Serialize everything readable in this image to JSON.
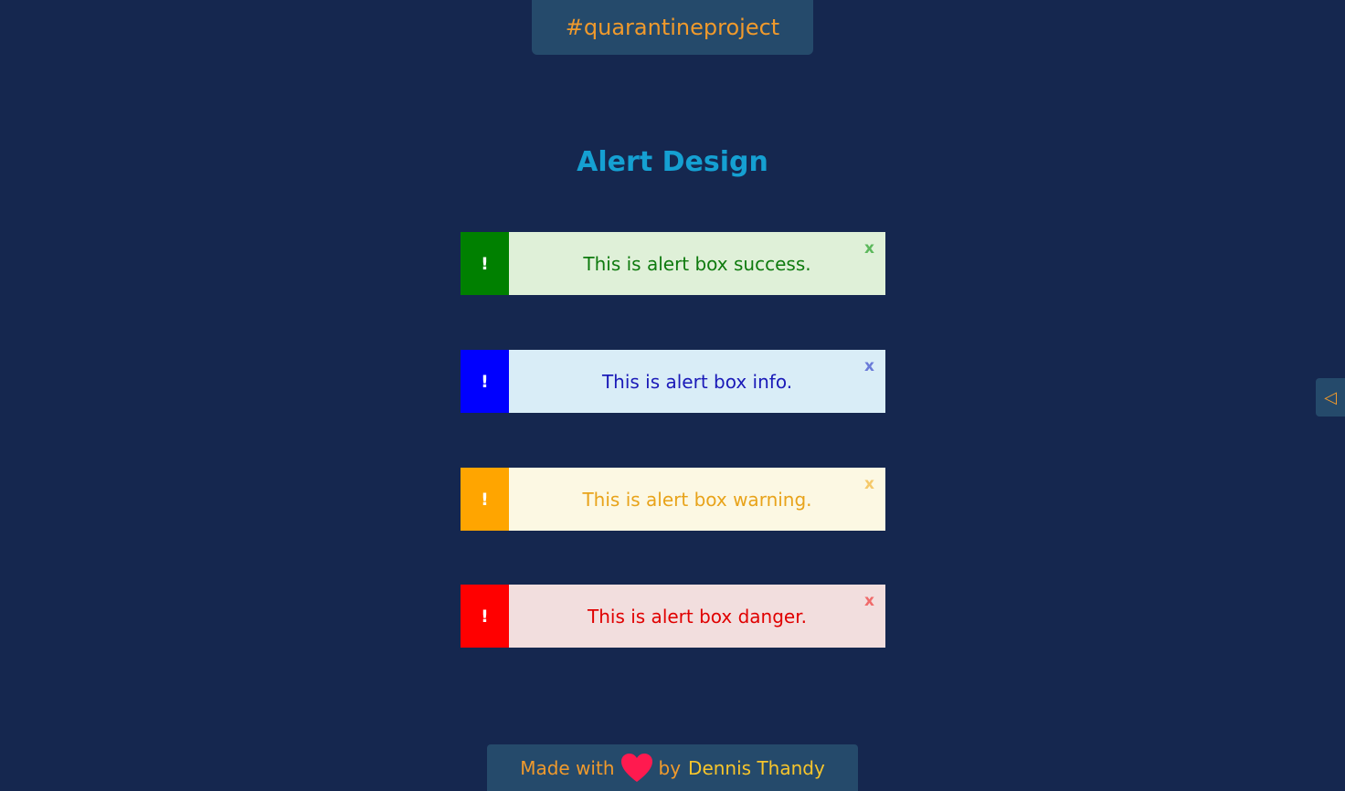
{
  "header": {
    "tag": "#quarantineproject"
  },
  "main": {
    "title": "Alert Design",
    "alerts": [
      {
        "type": "success",
        "icon": "!",
        "message": "This is alert box success.",
        "close": "x",
        "accent": "#008000",
        "background": "#dff0d8",
        "text_color": "#0e7a0e",
        "close_color": "#5cb85c"
      },
      {
        "type": "info",
        "icon": "!",
        "message": "This is alert box info.",
        "close": "x",
        "accent": "#0000ff",
        "background": "#d9edf7",
        "text_color": "#1a1ab8",
        "close_color": "#6a7bd8"
      },
      {
        "type": "warning",
        "icon": "!",
        "message": "This is alert box warning.",
        "close": "x",
        "accent": "#ffa500",
        "background": "#fcf8e3",
        "text_color": "#e8a31a",
        "close_color": "#f5c96a"
      },
      {
        "type": "danger",
        "icon": "!",
        "message": "This is alert box danger.",
        "close": "x",
        "accent": "#ff0000",
        "background": "#f2dede",
        "text_color": "#e00000",
        "close_color": "#f06a6a"
      }
    ]
  },
  "footer": {
    "made_with": "Made with",
    "by": "by",
    "author": "Dennis Thandy",
    "heart_icon": "heart-icon",
    "heart_color": "#ff1a4f"
  },
  "side_tab": {
    "icon": "◁",
    "icon_name": "triangle-left-icon"
  },
  "colors": {
    "background": "#15274f",
    "panel": "#254a6b",
    "accent_orange": "#f09a2c",
    "title_blue": "#15a0d2"
  }
}
